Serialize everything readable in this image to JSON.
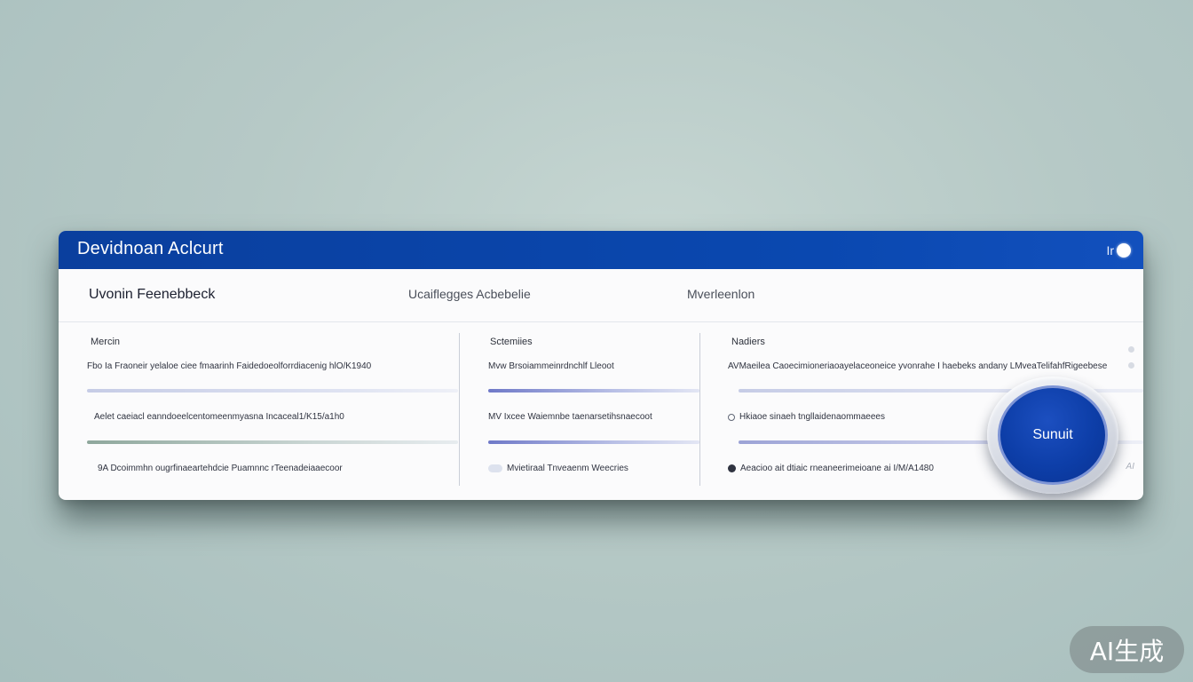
{
  "window": {
    "title": "Devidnoan Aclcurt",
    "toggle_label": "Ir"
  },
  "tabs": [
    {
      "label": "Uvonin Feenebbeck"
    },
    {
      "label": "Ucaiflegges Acbebelie"
    },
    {
      "label": "Mverleenlon"
    }
  ],
  "columns": [
    {
      "heading": "Mercin",
      "rows": [
        {
          "text": "Fbo Ia Fraoneir yelaloe ciee fmaarinh Faidedoeolforrdiacenig hlO/K1940"
        },
        {
          "text": "Aelet caeiacl eanndoeelcentomeenmyasna Incaceal1/K15/a1h0"
        },
        {
          "text": "9A Dcoimmhn ougrfinaeartehdcie Puamnnc rTeenadeiaaecoor"
        }
      ]
    },
    {
      "heading": "Sctemiies",
      "rows": [
        {
          "text": "Mvw Brsoiammeinrdnchlf Lleoot"
        },
        {
          "text": "MV Ixcee Waiemnbe taenarsetihsnaecoot"
        },
        {
          "text": "Mvietiraal Tnveaenm Weecries"
        }
      ]
    },
    {
      "heading": "Nadiers",
      "rows": [
        {
          "text": "AVMaeilea Caoecimioneriaoayelaceoneice yvonrahe I haebeks andany LMveaTelifahfRigeebese"
        },
        {
          "text": "Hkiaoe sinaeh tngllaidenaommaeees"
        },
        {
          "text": "Aeacioo ait dtiaic rneaneerimeioane ai I/M/A1480"
        }
      ]
    }
  ],
  "progress": {
    "c1_bar1": 1.0,
    "c1_bar2": 1.0,
    "c2_bar1": 1.0,
    "c2_bar2": 1.0,
    "c3_bar1": 1.0,
    "c3_bar2": 1.0
  },
  "side_label": "AI",
  "submit": {
    "label": "Sunuit"
  },
  "watermark": "AI生成",
  "colors": {
    "title_bar": "#0a48b0",
    "submit": "#0d3ea8",
    "background": "#b6c9c6"
  }
}
